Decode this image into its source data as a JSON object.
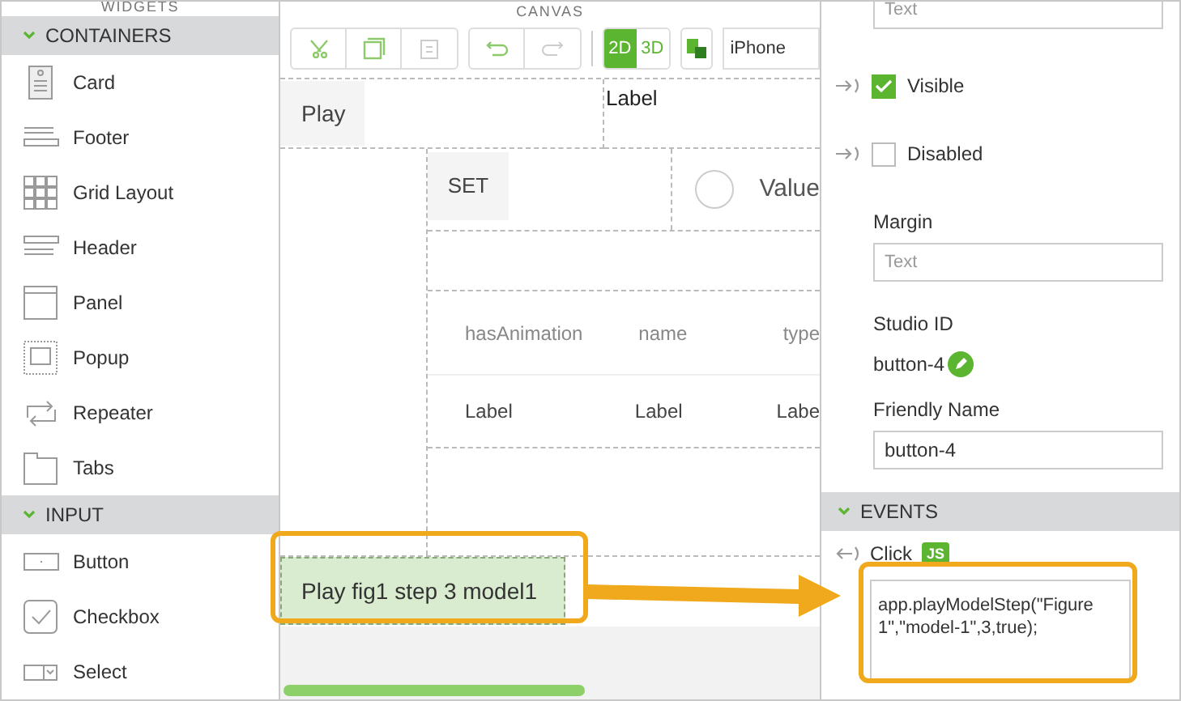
{
  "widgets": {
    "title": "WIDGETS",
    "sections": [
      {
        "title": "CONTAINERS",
        "expanded": true,
        "items": [
          {
            "label": "Card",
            "kind": "card"
          },
          {
            "label": "Footer",
            "kind": "footer"
          },
          {
            "label": "Grid Layout",
            "kind": "grid"
          },
          {
            "label": "Header",
            "kind": "header"
          },
          {
            "label": "Panel",
            "kind": "panel"
          },
          {
            "label": "Popup",
            "kind": "popup"
          },
          {
            "label": "Repeater",
            "kind": "repeater"
          },
          {
            "label": "Tabs",
            "kind": "tabs"
          }
        ]
      },
      {
        "title": "INPUT",
        "expanded": true,
        "items": [
          {
            "label": "Button",
            "kind": "button"
          },
          {
            "label": "Checkbox",
            "kind": "checkbox"
          },
          {
            "label": "Select",
            "kind": "select"
          }
        ]
      }
    ]
  },
  "canvas": {
    "title": "CANVAS",
    "modes": [
      {
        "label": "2D",
        "selected": true
      },
      {
        "label": "3D",
        "selected": false
      }
    ],
    "device": "iPhone",
    "play_button": "Play",
    "label": "Label",
    "set_button": "SET",
    "radio": {
      "label": "Value",
      "checked": false
    },
    "table": {
      "columns": [
        "hasAnimation",
        "name",
        "type"
      ],
      "rows": [
        [
          "Label",
          "Label",
          "Labe"
        ]
      ]
    },
    "selected_button": "Play fig1 step 3 model1"
  },
  "properties": {
    "top_field": {
      "placeholder": "Text"
    },
    "checkboxes": [
      {
        "label": "Visible",
        "checked": true
      },
      {
        "label": "Disabled",
        "checked": false
      }
    ],
    "margin": {
      "label": "Margin",
      "placeholder": "Text"
    },
    "studio_id": {
      "label": "Studio ID",
      "value": "button-4"
    },
    "friendly_name": {
      "label": "Friendly Name",
      "value": "button-4"
    },
    "events": {
      "title": "EVENTS",
      "expanded": true,
      "items": [
        {
          "label": "Click",
          "badge": "JS",
          "code": "app.playModelStep(\"Figure 1\",\"model-1\",3,true);"
        }
      ]
    }
  }
}
